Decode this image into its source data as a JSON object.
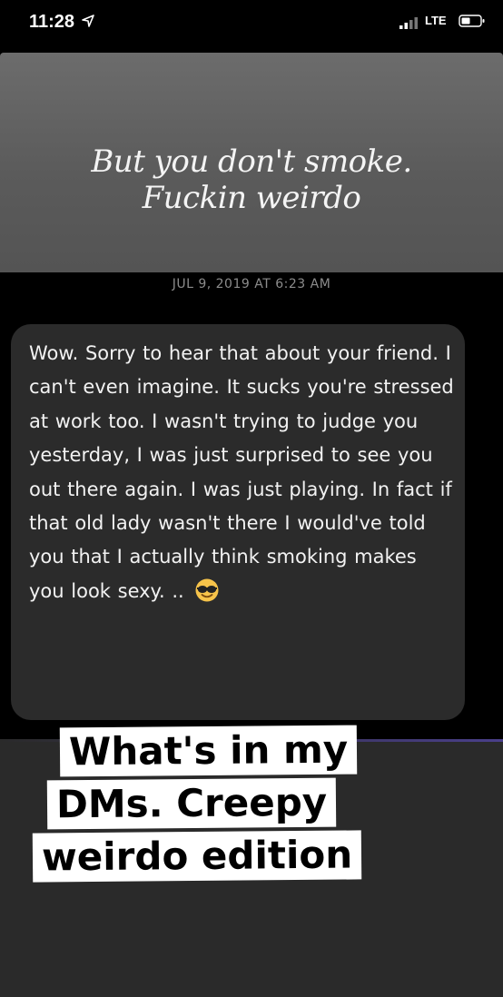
{
  "status_bar": {
    "time": "11:28",
    "network": "LTE"
  },
  "story_reply": {
    "caption_lines": [
      "But you don't smoke.",
      "Fuckin weirdo"
    ]
  },
  "timestamp": "JUL 9, 2019 AT 6:23 AM",
  "message": {
    "text": "Wow. Sorry to hear that about your friend. I can't even imagine. It sucks you're stressed at work too. I wasn't trying to judge you yesterday, I was just surprised to see you out there again.  I was just playing. In fact if that old lady wasn't there I would've told you that I actually think smoking makes you look sexy. ..",
    "emoji": "smiling-face-with-sunglasses"
  },
  "sticker_text": {
    "lines": [
      "What's in my",
      "DMs. Creepy",
      "weirdo edition"
    ]
  },
  "colors": {
    "background": "#000000",
    "story_card": "#5f5f5f",
    "bubble": "#2b2b2b",
    "bottom_area": "#2a2a2a",
    "sticker_bg": "#ffffff"
  }
}
